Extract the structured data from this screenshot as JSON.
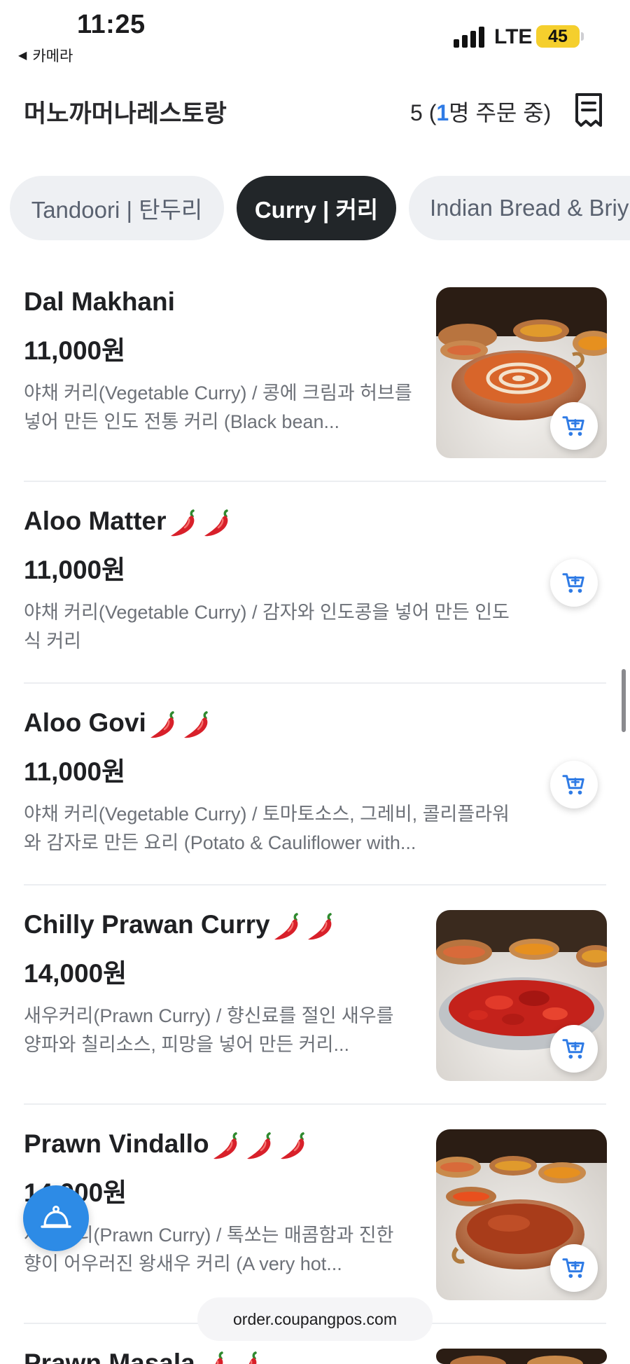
{
  "status_bar": {
    "time": "11:25",
    "back_label": "카메라",
    "network": "LTE",
    "battery": "45"
  },
  "header": {
    "shop_name": "머노까머나레스토랑",
    "order_prefix": "5 (",
    "order_highlight": "1",
    "order_suffix": "명 주문 중)",
    "receipt_icon": "receipt-icon"
  },
  "tabs": [
    {
      "label": "Tandoori | 탄두리",
      "active": false
    },
    {
      "label": "Curry | 커리",
      "active": true
    },
    {
      "label": "Indian Bread & Briy",
      "active": false
    }
  ],
  "menu": [
    {
      "name": "Dal Makhani",
      "chili": 0,
      "price": "11,000원",
      "desc": "야채 커리(Vegetable Curry) / 콩에 크림과 허브를 넣어 만든 인도 전통 커리 (Black bean...",
      "has_image": true
    },
    {
      "name": "Aloo Matter",
      "chili": 2,
      "price": "11,000원",
      "desc": "야채 커리(Vegetable Curry) / 감자와 인도콩을 넣어 만든 인도식 커리",
      "has_image": false
    },
    {
      "name": "Aloo Govi",
      "chili": 2,
      "price": "11,000원",
      "desc": "야채 커리(Vegetable Curry) / 토마토소스, 그레비, 콜리플라워와 감자로 만든 요리 (Potato & Cauliflower with...",
      "has_image": false
    },
    {
      "name": "Chilly Prawan Curry",
      "chili": 2,
      "price": "14,000원",
      "desc": "새우커리(Prawn Curry) / 향신료를 절인 새우를 양파와 칠리소스, 피망을 넣어 만든 커리...",
      "has_image": true
    },
    {
      "name": "Prawn Vindallo",
      "chili": 3,
      "price": "14,000원",
      "desc": "새우커리(Prawn Curry) / 톡쏘는 매콤함과 진한 향이 어우러진 왕새우 커리 (A very hot...",
      "has_image": true
    },
    {
      "name": "Prawn Masala",
      "chili": 2,
      "price": "",
      "desc": "",
      "has_image": true
    }
  ],
  "floating": {
    "url": "order.coupangpos.com",
    "fab_icon": "cloche-icon"
  },
  "colors": {
    "accent": "#2f7be5",
    "tab_active_bg": "#222629",
    "tab_bg": "#eef0f3",
    "battery": "#f5cf2d",
    "fab": "#2d8be6"
  }
}
